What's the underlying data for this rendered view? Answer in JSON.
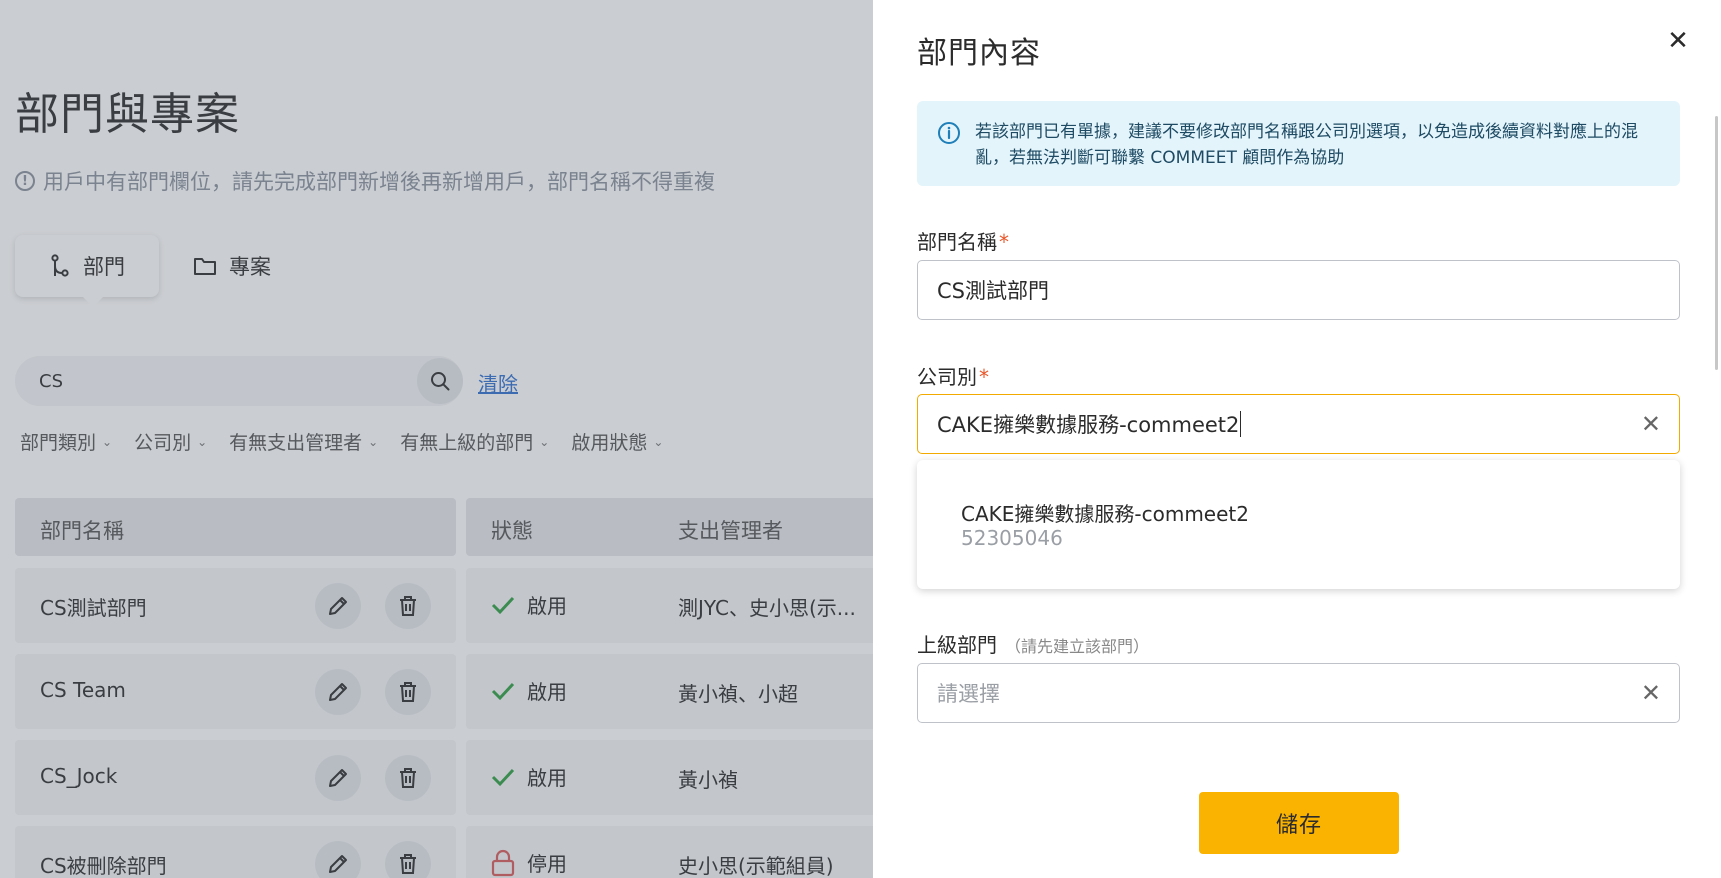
{
  "background": {
    "title": "部門與專案",
    "hint": "用戶中有部門欄位，請先完成部門新增後再新增用戶，部門名稱不得重複",
    "tabs": [
      {
        "label": "部門",
        "icon": "branch-icon",
        "active": true
      },
      {
        "label": "專案",
        "icon": "folder-icon",
        "active": false
      }
    ],
    "search": {
      "value": "CS",
      "clear_label": "清除"
    },
    "filters": [
      "部門類別",
      "公司別",
      "有無支出管理者",
      "有無上級的部門",
      "啟用狀態"
    ],
    "table": {
      "headers": {
        "name": "部門名稱",
        "status": "狀態",
        "manager": "支出管理者"
      },
      "rows": [
        {
          "name": "CS測試部門",
          "status": "啟用",
          "status_type": "enabled",
          "manager": "測JYC、史小思(示..."
        },
        {
          "name": "CS Team",
          "status": "啟用",
          "status_type": "enabled",
          "manager": "黃小禎、小超"
        },
        {
          "name": "CS_Jock",
          "status": "啟用",
          "status_type": "enabled",
          "manager": "黃小禎"
        },
        {
          "name": "CS被刪除部門",
          "status": "停用",
          "status_type": "disabled",
          "manager": "史小思(示範組員)"
        }
      ]
    }
  },
  "drawer": {
    "title": "部門內容",
    "info": "若該部門已有單據，建議不要修改部門名稱跟公司別選項，以免造成後續資料對應上的混亂，若無法判斷可聯繫 COMMEET 顧問作為協助",
    "dept_name": {
      "label": "部門名稱",
      "required": "*",
      "value": "CS測試部門"
    },
    "company": {
      "label": "公司別",
      "required": "*",
      "value": "CAKE擁樂數據服務-commeet2"
    },
    "company_option": {
      "name": "CAKE擁樂數據服務-commeet2",
      "id": "52305046"
    },
    "parent": {
      "label": "上級部門",
      "sub_label": "（請先建立該部門）",
      "placeholder": "請選擇"
    },
    "save_label": "儲存",
    "close_symbol": "✕",
    "clear_symbol": "✕"
  },
  "colors": {
    "accent": "#f9b300",
    "focus_border": "#f2a900",
    "info_bg": "#e3f4fb",
    "enabled_check": "#2ea043",
    "disabled_lock": "#d95b5b",
    "link": "#2f6fd1"
  }
}
